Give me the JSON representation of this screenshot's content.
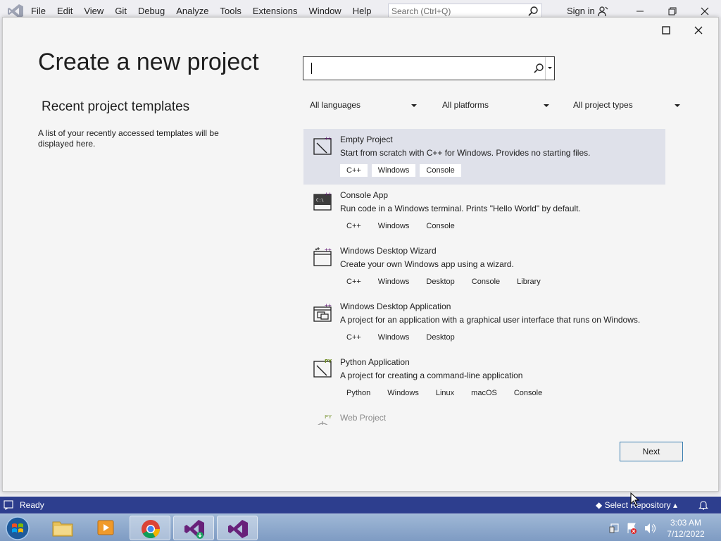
{
  "menu": {
    "items": [
      "File",
      "Edit",
      "View",
      "Git",
      "Debug",
      "Analyze",
      "Tools",
      "Extensions",
      "Window",
      "Help"
    ],
    "search_placeholder": "Search (Ctrl+Q)",
    "sign_in": "Sign in"
  },
  "dialog": {
    "title": "Create a new project",
    "recent_heading": "Recent project templates",
    "recent_description": "A list of your recently accessed templates will be displayed here.",
    "search_value": "",
    "filters": {
      "language": "All languages",
      "platform": "All platforms",
      "project_type": "All project types"
    },
    "templates": [
      {
        "name": "Empty Project",
        "description": "Start from scratch with C++ for Windows. Provides no starting files.",
        "tags": [
          "C++",
          "Windows",
          "Console"
        ],
        "icon": "empty-project-icon",
        "selected": true
      },
      {
        "name": "Console App",
        "description": "Run code in a Windows terminal. Prints \"Hello World\" by default.",
        "tags": [
          "C++",
          "Windows",
          "Console"
        ],
        "icon": "console-app-icon",
        "selected": false
      },
      {
        "name": "Windows Desktop Wizard",
        "description": "Create your own Windows app using a wizard.",
        "tags": [
          "C++",
          "Windows",
          "Desktop",
          "Console",
          "Library"
        ],
        "icon": "desktop-wizard-icon",
        "selected": false
      },
      {
        "name": "Windows Desktop Application",
        "description": "A project for an application with a graphical user interface that runs on Windows.",
        "tags": [
          "C++",
          "Windows",
          "Desktop"
        ],
        "icon": "desktop-application-icon",
        "selected": false
      },
      {
        "name": "Python Application",
        "description": "A project for creating a command-line application",
        "tags": [
          "Python",
          "Windows",
          "Linux",
          "macOS",
          "Console"
        ],
        "icon": "python-application-icon",
        "selected": false
      },
      {
        "name": "Web Project",
        "description": "",
        "tags": [],
        "icon": "web-project-icon",
        "selected": false
      }
    ],
    "next_label": "Next"
  },
  "statusbar": {
    "status": "Ready",
    "repo": "Select Repository"
  },
  "taskbar": {
    "time": "3:03 AM",
    "date": "7/12/2022"
  },
  "colors": {
    "statusbar": "#2d3e8e",
    "selected_row": "#dfe1ea",
    "vs_purple": "#68217a"
  }
}
